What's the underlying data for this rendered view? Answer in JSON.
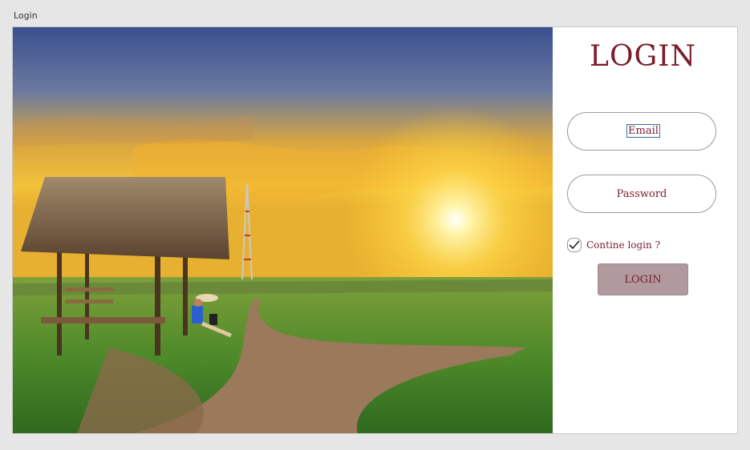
{
  "window": {
    "title": "Login"
  },
  "hero": {
    "description_icon": "sunset-field-photo"
  },
  "form": {
    "heading": "LOGIN",
    "email_placeholder": "Email",
    "password_placeholder": "Password",
    "remember_label": "Contine login ?",
    "remember_checked": true,
    "submit_label": "LOGIN"
  },
  "colors": {
    "accent": "#7a1c2c",
    "button_bg": "#b09a9d",
    "window_bg": "#e6e6e6"
  }
}
